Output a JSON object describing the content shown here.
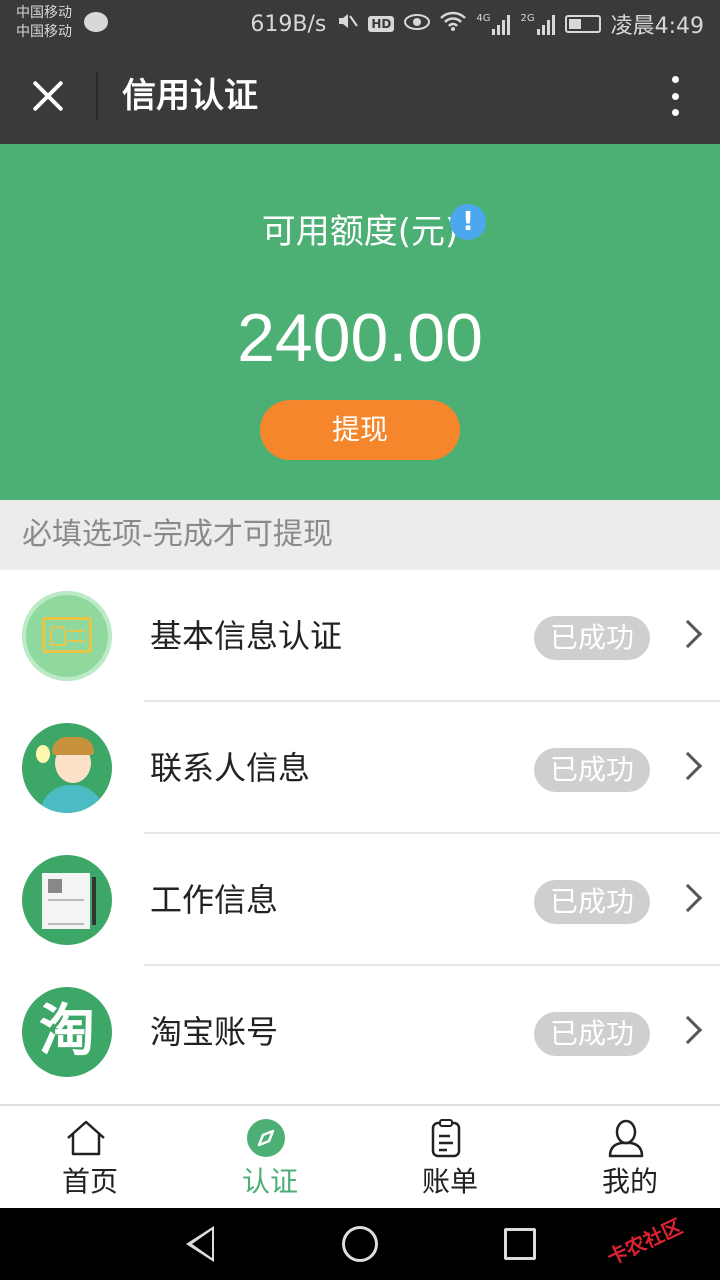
{
  "status_bar": {
    "carrier_1": "中国移动",
    "carrier_2": "中国移动",
    "net_speed": "619B/s",
    "hd_label": "HD",
    "network_1": "4G",
    "network_2": "2G",
    "time": "凌晨4:49"
  },
  "header": {
    "title": "信用认证",
    "close_icon": "close-icon",
    "more_icon": "more-vertical-icon"
  },
  "credit": {
    "label": "可用额度(元)",
    "info_glyph": "!",
    "amount": "2400.00",
    "withdraw_label": "提现",
    "colors": {
      "panel": "#4caf74",
      "button": "#f5862b",
      "info": "#4ba7ee"
    }
  },
  "section": {
    "title": "必填选项-完成才可提现"
  },
  "cert_items": [
    {
      "label": "基本信息认证",
      "status": "已成功",
      "icon": "id-card-icon"
    },
    {
      "label": "联系人信息",
      "status": "已成功",
      "icon": "person-avatar-icon"
    },
    {
      "label": "工作信息",
      "status": "已成功",
      "icon": "document-icon"
    },
    {
      "label": "淘宝账号",
      "status": "已成功",
      "icon": "taobao-icon",
      "glyph": "淘"
    }
  ],
  "tabs": [
    {
      "label": "首页",
      "icon": "home-icon",
      "active": false
    },
    {
      "label": "认证",
      "icon": "compass-icon",
      "active": true
    },
    {
      "label": "账单",
      "icon": "clipboard-icon",
      "active": false
    },
    {
      "label": "我的",
      "icon": "user-icon",
      "active": false
    }
  ],
  "watermark": "卡农社区"
}
